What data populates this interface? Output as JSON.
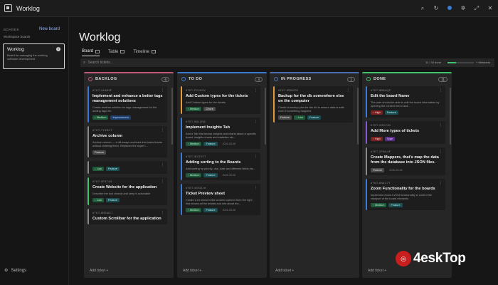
{
  "app": {
    "title": "Worklog"
  },
  "colors": {
    "backlog": "#c45a7a",
    "todo": "#3a7bd5",
    "inprogress": "#4a6fb5",
    "done": "#3ec46d",
    "accent_blue": "#3a7bd5",
    "accent_orange": "#e39b3a",
    "accent_green": "#3ec46d",
    "accent_purple": "#8a56d6"
  },
  "sidebar": {
    "boards_label": "BOARDS",
    "new_board_label": "New board",
    "workspace_label": "Workspace boards",
    "board": {
      "title": "Worklog",
      "desc": "Board for managing the worklog software development"
    },
    "settings_label": "Settings"
  },
  "main": {
    "title": "Worklog",
    "tabs": [
      {
        "label": "Board"
      },
      {
        "label": "Table"
      },
      {
        "label": "Timeline"
      }
    ],
    "search_placeholder": "Search tickets...",
    "progress": {
      "text": "11 / 34 done",
      "fraction": 0.32,
      "label": "+ Members"
    }
  },
  "columns": [
    {
      "title": "BACKLOG",
      "count": "6",
      "color": "#c45a7a",
      "add_label": "Add ticket +",
      "cards": [
        {
          "id": "#TKT-1A4B9F",
          "title": "Implement and enhance a better tags management solutions",
          "desc": "Create another solution for tags management for the adding tags etc",
          "accent": "#3a7bd5",
          "badges": [
            {
              "text": "↑ Medium",
              "cls": "b-green"
            },
            {
              "text": "Improvement",
              "cls": "b-blue"
            }
          ],
          "date": ""
        },
        {
          "id": "#TKT-7Y0RCT",
          "title": "Archive column",
          "desc": "Archive column — a dif-aways archived that hides tickets without deleting them. Replaces the super l...",
          "accent": "#8a8a8a",
          "badges": [
            {
              "text": "Feature",
              "cls": "b-gray"
            }
          ],
          "date": ""
        },
        {
          "id": "",
          "title": "",
          "desc": "",
          "accent": "#8a8a8a",
          "badges": [
            {
              "text": "↓ Low",
              "cls": "b-green"
            },
            {
              "text": "Feature",
              "cls": "b-teal"
            }
          ],
          "date": ""
        },
        {
          "id": "#TKT-9P3T4G",
          "title": "Create Website for the application",
          "desc": "Describe the tool cleanly and keep it actionable",
          "accent": "#3ec46d",
          "badges": [
            {
              "text": "↓ Low",
              "cls": "b-green"
            },
            {
              "text": "Feature",
              "cls": "b-teal"
            }
          ],
          "date": ""
        },
        {
          "id": "#TKT-8R0MC7",
          "title": "Custom Scrollbar for the application",
          "desc": "",
          "accent": "#8a8a8a",
          "badges": [],
          "date": ""
        }
      ]
    },
    {
      "title": "TO DO",
      "count": "4",
      "color": "#3a7bd5",
      "add_label": "Add ticket +",
      "cards": [
        {
          "id": "#TKT-PY9H3V",
          "title": "Add Custom types for the tickets",
          "desc": "Add Custom types for the tickets",
          "accent": "#e39b3a",
          "badges": [
            {
              "text": "↑ Medium",
              "cls": "b-green"
            },
            {
              "text": "Chore",
              "cls": "b-gray"
            }
          ],
          "date": ""
        },
        {
          "id": "#TKT-9QL2N8",
          "title": "Implement Insights Tab",
          "desc": "Add a Tab that shows insights and charts about a specific board, insights charts and statistics etc...",
          "accent": "#3a7bd5",
          "badges": [
            {
              "text": "↑ Medium",
              "cls": "b-green"
            },
            {
              "text": "Feature",
              "cls": "b-teal"
            }
          ],
          "date": "2026-05-08"
        },
        {
          "id": "#TKT-W4T0YT",
          "title": "Adding sorting to the Boards",
          "desc": "Add sorting by priority, due_date and different fields etc...",
          "accent": "#3a7bd5",
          "badges": [
            {
              "text": "↑ Medium",
              "cls": "b-green"
            },
            {
              "text": "Feature",
              "cls": "b-teal"
            }
          ],
          "date": "2026-05-08"
        },
        {
          "id": "#TKT-4SSQ1H",
          "title": "Ticket Preview sheet",
          "desc": "Create a UI element like a sheet opened from the right that shows all the details and info about the...",
          "accent": "#3a7bd5",
          "badges": [
            {
              "text": "↑ Medium",
              "cls": "b-green"
            },
            {
              "text": "Feature",
              "cls": "b-teal"
            }
          ],
          "date": "2026-05-08"
        }
      ]
    },
    {
      "title": "IN PROGRESS",
      "count": "1",
      "color": "#4a6fb5",
      "add_label": "Add ticket +",
      "cards": [
        {
          "id": "#TKT-3RB2PD",
          "title": "Backup for the db somewhere else on the computer",
          "desc": "Create a backup plan for the db to ensure data is safe even if something happens",
          "accent": "#e39b3a",
          "badges": [
            {
              "text": "Feature",
              "cls": "b-gray"
            },
            {
              "text": "↓ Low",
              "cls": "b-green"
            },
            {
              "text": "Feature",
              "cls": "b-teal"
            }
          ],
          "date": ""
        }
      ]
    },
    {
      "title": "DONE",
      "count": "11",
      "color": "#3ec46d",
      "add_label": "Add ticket +",
      "cards": [
        {
          "id": "#TKT-8BB4QP",
          "title": "Edit the board Name",
          "desc": "The user should be able to edit the board information by opening the context menu and...",
          "accent": "#3a7bd5",
          "badges": [
            {
              "text": "↑ High",
              "cls": "b-red"
            },
            {
              "text": "Feature",
              "cls": "b-teal"
            }
          ],
          "date": ""
        },
        {
          "id": "#TKT-G3C2JN",
          "title": "Add More types of tickets",
          "desc": "",
          "accent": "#8a56d6",
          "badges": [
            {
              "text": "↑ High",
              "cls": "b-red"
            },
            {
              "text": "Type",
              "cls": "b-purple"
            }
          ],
          "date": ""
        },
        {
          "id": "#TKT-1PWL4F",
          "title": "Create Mappers, that's map the data from the database into JSON files.",
          "desc": "",
          "accent": "#8a8a8a",
          "badges": [
            {
              "text": "Feature",
              "cls": "b-gray"
            }
          ],
          "date": "2026-05-08"
        },
        {
          "id": "#TKT-8N6C7Y",
          "title": "Zoom Functionality for the boards",
          "desc": "Implement Zoom In/Out functionality to control the viewport of the board elements",
          "accent": "#3a7bd5",
          "badges": [
            {
              "text": "↑ Medium",
              "cls": "b-green"
            },
            {
              "text": "Feature",
              "cls": "b-teal"
            }
          ],
          "date": ""
        }
      ]
    }
  ],
  "watermark": {
    "text": "4eskTop"
  }
}
